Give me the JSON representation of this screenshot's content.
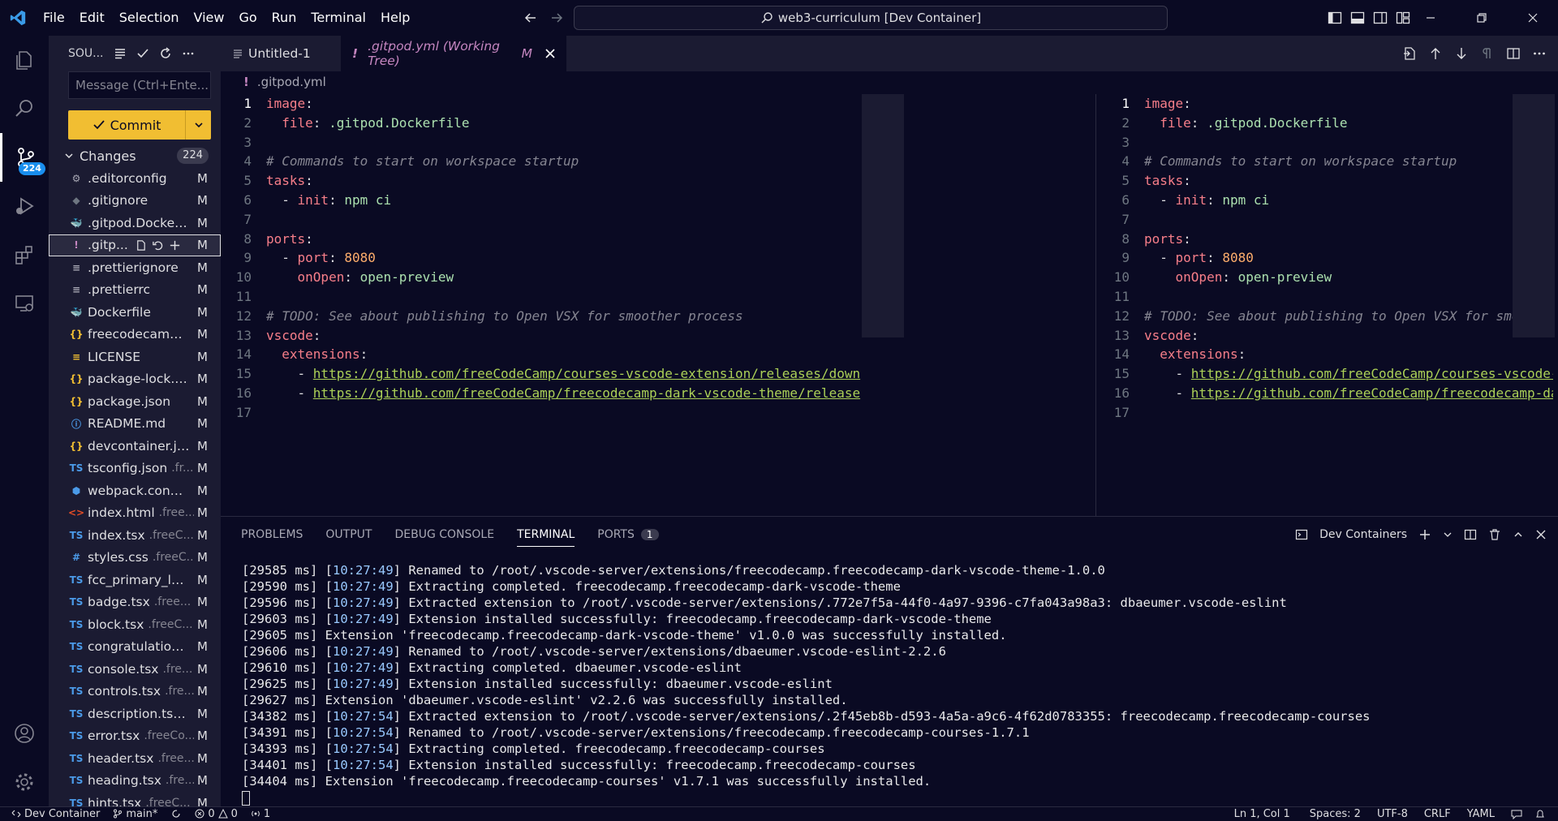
{
  "menu": [
    "File",
    "Edit",
    "Selection",
    "View",
    "Go",
    "Run",
    "Terminal",
    "Help"
  ],
  "command_center": "web3-curriculum [Dev Container]",
  "activity": {
    "scm_badge": "224"
  },
  "sidebar": {
    "title": "SOU...",
    "message_placeholder": "Message (Ctrl+Ente...",
    "commit_label": "Commit",
    "changes_label": "Changes",
    "changes_count": "224",
    "files": [
      {
        "icon": "⚙",
        "icon_color": "#a8a8b4",
        "name": ".editorconfig",
        "path": "",
        "status": "M"
      },
      {
        "icon": "◆",
        "icon_color": "#6e7681",
        "name": ".gitignore",
        "path": "",
        "status": "M"
      },
      {
        "icon": "🐳",
        "icon_color": "#4b9ae8",
        "name": ".gitpod.Dockerf...",
        "path": "",
        "status": "M"
      },
      {
        "icon": "!",
        "icon_color": "#c586c0",
        "name": ".gitp...",
        "path": "",
        "status": "M",
        "selected": true
      },
      {
        "icon": "≡",
        "icon_color": "#a8a8b4",
        "name": ".prettierignore",
        "path": "",
        "status": "M"
      },
      {
        "icon": "≡",
        "icon_color": "#a8a8b4",
        "name": ".prettierrc",
        "path": "",
        "status": "M"
      },
      {
        "icon": "🐳",
        "icon_color": "#4b9ae8",
        "name": "Dockerfile",
        "path": "",
        "status": "M"
      },
      {
        "icon": "{}",
        "icon_color": "#f1be32",
        "name": "freecodecamp.c...",
        "path": "",
        "status": "M"
      },
      {
        "icon": "≡",
        "icon_color": "#f1be32",
        "name": "LICENSE",
        "path": "",
        "status": "M"
      },
      {
        "icon": "{}",
        "icon_color": "#f1be32",
        "name": "package-lock.js...",
        "path": "",
        "status": "M"
      },
      {
        "icon": "{}",
        "icon_color": "#f1be32",
        "name": "package.json",
        "path": "",
        "status": "M"
      },
      {
        "icon": "ⓘ",
        "icon_color": "#4b9ae8",
        "name": "README.md",
        "path": "",
        "status": "M"
      },
      {
        "icon": "{}",
        "icon_color": "#f1be32",
        "name": "devcontainer.js...",
        "path": "",
        "status": "M"
      },
      {
        "icon": "TS",
        "icon_color": "#4b9ae8",
        "name": "tsconfig.json",
        "path": ".fr...",
        "status": "M"
      },
      {
        "icon": "⬢",
        "icon_color": "#4b9ae8",
        "name": "webpack.config...",
        "path": "",
        "status": "M"
      },
      {
        "icon": "<>",
        "icon_color": "#e34c26",
        "name": "index.html",
        "path": ".free...",
        "status": "M"
      },
      {
        "icon": "TS",
        "icon_color": "#4b9ae8",
        "name": "index.tsx",
        "path": ".freeC...",
        "status": "M"
      },
      {
        "icon": "#",
        "icon_color": "#4b9ae8",
        "name": "styles.css",
        "path": ".freeC...",
        "status": "M"
      },
      {
        "icon": "TS",
        "icon_color": "#4b9ae8",
        "name": "fcc_primary_lar...",
        "path": "",
        "status": "M"
      },
      {
        "icon": "TS",
        "icon_color": "#4b9ae8",
        "name": "badge.tsx",
        "path": ".free...",
        "status": "M"
      },
      {
        "icon": "TS",
        "icon_color": "#4b9ae8",
        "name": "block.tsx",
        "path": ".freeC...",
        "status": "M"
      },
      {
        "icon": "TS",
        "icon_color": "#4b9ae8",
        "name": "congratulations...",
        "path": "",
        "status": "M"
      },
      {
        "icon": "TS",
        "icon_color": "#4b9ae8",
        "name": "console.tsx",
        "path": ".fre...",
        "status": "M"
      },
      {
        "icon": "TS",
        "icon_color": "#4b9ae8",
        "name": "controls.tsx",
        "path": ".fre...",
        "status": "M"
      },
      {
        "icon": "TS",
        "icon_color": "#4b9ae8",
        "name": "description.tsx...",
        "path": "",
        "status": "M"
      },
      {
        "icon": "TS",
        "icon_color": "#4b9ae8",
        "name": "error.tsx",
        "path": ".freeCo...",
        "status": "M"
      },
      {
        "icon": "TS",
        "icon_color": "#4b9ae8",
        "name": "header.tsx",
        "path": ".free...",
        "status": "M"
      },
      {
        "icon": "TS",
        "icon_color": "#4b9ae8",
        "name": "heading.tsx",
        "path": ".fre...",
        "status": "M"
      },
      {
        "icon": "TS",
        "icon_color": "#4b9ae8",
        "name": "hints.tsx",
        "path": ".freeC...",
        "status": "M"
      }
    ]
  },
  "tabs": {
    "untitled": "Untitled-1",
    "active_prefix": "!",
    "active_label": ".gitpod.yml (Working Tree)",
    "active_status": "M"
  },
  "editor": {
    "breadcrumb_icon": "!",
    "breadcrumb": ".gitpod.yml",
    "lines": [
      {
        "n": "1",
        "t": [
          {
            "c": "k",
            "v": "image"
          },
          {
            "c": "p",
            "v": ":"
          }
        ]
      },
      {
        "n": "2",
        "t": [
          {
            "c": "p",
            "v": "  "
          },
          {
            "c": "k",
            "v": "file"
          },
          {
            "c": "p",
            "v": ": "
          },
          {
            "c": "str",
            "v": ".gitpod.Dockerfile"
          }
        ]
      },
      {
        "n": "3",
        "t": []
      },
      {
        "n": "4",
        "t": [
          {
            "c": "c",
            "v": "# Commands to start on workspace startup"
          }
        ]
      },
      {
        "n": "5",
        "t": [
          {
            "c": "k",
            "v": "tasks"
          },
          {
            "c": "p",
            "v": ":"
          }
        ]
      },
      {
        "n": "6",
        "t": [
          {
            "c": "p",
            "v": "  - "
          },
          {
            "c": "k",
            "v": "init"
          },
          {
            "c": "p",
            "v": ": "
          },
          {
            "c": "str",
            "v": "npm ci"
          }
        ]
      },
      {
        "n": "7",
        "t": []
      },
      {
        "n": "8",
        "t": [
          {
            "c": "k",
            "v": "ports"
          },
          {
            "c": "p",
            "v": ":"
          }
        ]
      },
      {
        "n": "9",
        "t": [
          {
            "c": "p",
            "v": "  - "
          },
          {
            "c": "k",
            "v": "port"
          },
          {
            "c": "p",
            "v": ": "
          },
          {
            "c": "n",
            "v": "8080"
          }
        ]
      },
      {
        "n": "10",
        "t": [
          {
            "c": "p",
            "v": "    "
          },
          {
            "c": "k",
            "v": "onOpen"
          },
          {
            "c": "p",
            "v": ": "
          },
          {
            "c": "str",
            "v": "open-preview"
          }
        ]
      },
      {
        "n": "11",
        "t": []
      },
      {
        "n": "12",
        "t": [
          {
            "c": "c",
            "v": "# TODO: See about publishing to Open VSX for smoother process"
          }
        ]
      },
      {
        "n": "13",
        "t": [
          {
            "c": "k",
            "v": "vscode"
          },
          {
            "c": "p",
            "v": ":"
          }
        ]
      },
      {
        "n": "14",
        "t": [
          {
            "c": "p",
            "v": "  "
          },
          {
            "c": "k",
            "v": "extensions"
          },
          {
            "c": "p",
            "v": ":"
          }
        ]
      },
      {
        "n": "15",
        "t": [
          {
            "c": "p",
            "v": "    - "
          },
          {
            "c": "u",
            "v": "https://github.com/freeCodeCamp/courses-vscode-extension/releases/down"
          }
        ]
      },
      {
        "n": "16",
        "t": [
          {
            "c": "p",
            "v": "    - "
          },
          {
            "c": "u",
            "v": "https://github.com/freeCodeCamp/freecodecamp-dark-vscode-theme/release"
          }
        ]
      },
      {
        "n": "17",
        "t": []
      }
    ]
  },
  "panel": {
    "tabs": [
      "PROBLEMS",
      "OUTPUT",
      "DEBUG CONSOLE",
      "TERMINAL",
      "PORTS"
    ],
    "ports_badge": "1",
    "terminal_name": "Dev Containers",
    "lines": [
      {
        "ms": "[29585 ms]",
        "ts": "10:27:49",
        "msg": "Renamed to /root/.vscode-server/extensions/freecodecamp.freecodecamp-dark-vscode-theme-1.0.0"
      },
      {
        "ms": "[29590 ms]",
        "ts": "10:27:49",
        "msg": "Extracting completed. freecodecamp.freecodecamp-dark-vscode-theme"
      },
      {
        "ms": "[29596 ms]",
        "ts": "10:27:49",
        "msg": "Extracted extension to /root/.vscode-server/extensions/.772e7f5a-44f0-4a97-9396-c7fa043a98a3: dbaeumer.vscode-eslint"
      },
      {
        "ms": "[29603 ms]",
        "ts": "10:27:49",
        "msg": "Extension installed successfully: freecodecamp.freecodecamp-dark-vscode-theme"
      },
      {
        "ms": "[29605 ms]",
        "ts": "",
        "msg": "Extension 'freecodecamp.freecodecamp-dark-vscode-theme' v1.0.0 was successfully installed."
      },
      {
        "ms": "[29606 ms]",
        "ts": "10:27:49",
        "msg": "Renamed to /root/.vscode-server/extensions/dbaeumer.vscode-eslint-2.2.6"
      },
      {
        "ms": "[29610 ms]",
        "ts": "10:27:49",
        "msg": "Extracting completed. dbaeumer.vscode-eslint"
      },
      {
        "ms": "[29625 ms]",
        "ts": "10:27:49",
        "msg": "Extension installed successfully: dbaeumer.vscode-eslint"
      },
      {
        "ms": "[29627 ms]",
        "ts": "",
        "msg": "Extension 'dbaeumer.vscode-eslint' v2.2.6 was successfully installed."
      },
      {
        "ms": "[34382 ms]",
        "ts": "10:27:54",
        "msg": "Extracted extension to /root/.vscode-server/extensions/.2f45eb8b-d593-4a5a-a9c6-4f62d0783355: freecodecamp.freecodecamp-courses"
      },
      {
        "ms": "[34391 ms]",
        "ts": "10:27:54",
        "msg": "Renamed to /root/.vscode-server/extensions/freecodecamp.freecodecamp-courses-1.7.1"
      },
      {
        "ms": "[34393 ms]",
        "ts": "10:27:54",
        "msg": "Extracting completed. freecodecamp.freecodecamp-courses"
      },
      {
        "ms": "[34401 ms]",
        "ts": "10:27:54",
        "msg": "Extension installed successfully: freecodecamp.freecodecamp-courses"
      },
      {
        "ms": "[34404 ms]",
        "ts": "",
        "msg": "Extension 'freecodecamp.freecodecamp-courses' v1.7.1 was successfully installed."
      }
    ]
  },
  "status": {
    "remote": "Dev Container",
    "branch": "main*",
    "problems": "0",
    "warnings": "0",
    "ports": "1",
    "cursor": "Ln 1, Col 1",
    "spaces": "Spaces: 2",
    "encoding": "UTF-8",
    "eol": "CRLF",
    "language": "YAML"
  }
}
